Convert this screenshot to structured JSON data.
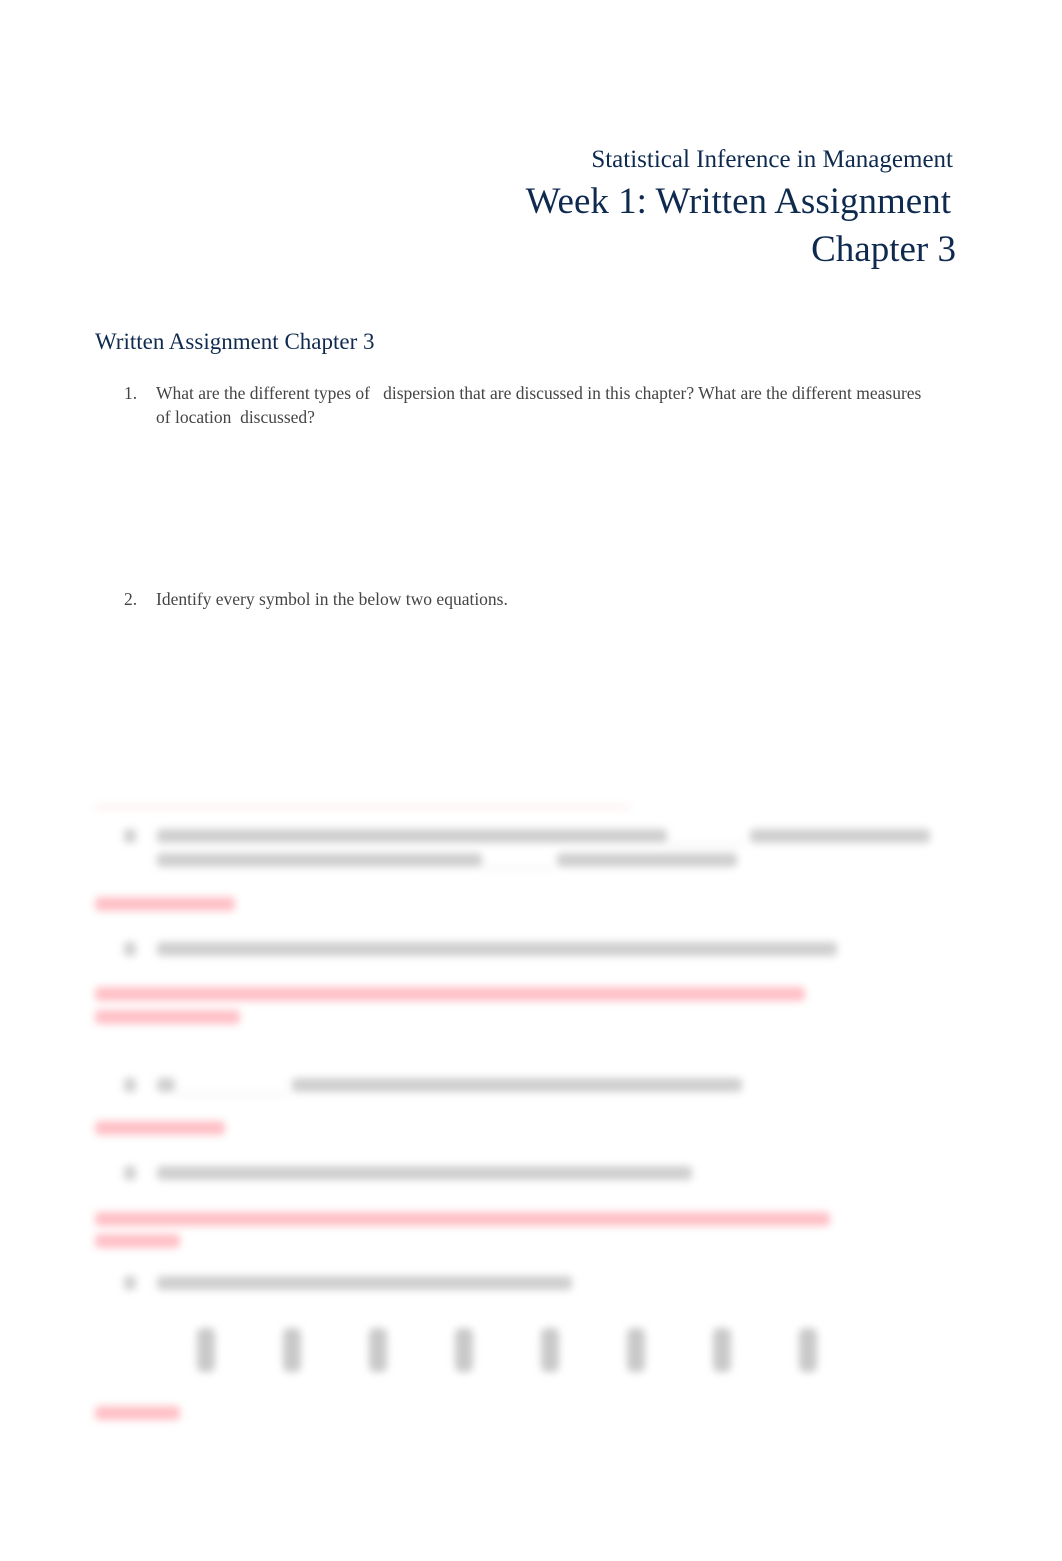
{
  "header": {
    "course": "Statistical Inference in Management",
    "title": "Week 1: Written Assignment",
    "chapter": "Chapter 3"
  },
  "section": {
    "heading": "Written Assignment Chapter 3"
  },
  "questions": [
    {
      "number": "1.",
      "text": "What are the different types of   dispersion that are discussed in this chapter? What are the different measures of location  discussed?"
    },
    {
      "number": "2.",
      "text": "Identify every symbol in the below two equations."
    }
  ],
  "blurred_preview": {
    "visible": true,
    "note_color_question": "#cfcfcf",
    "note_color_answer": "#ff6b78"
  }
}
